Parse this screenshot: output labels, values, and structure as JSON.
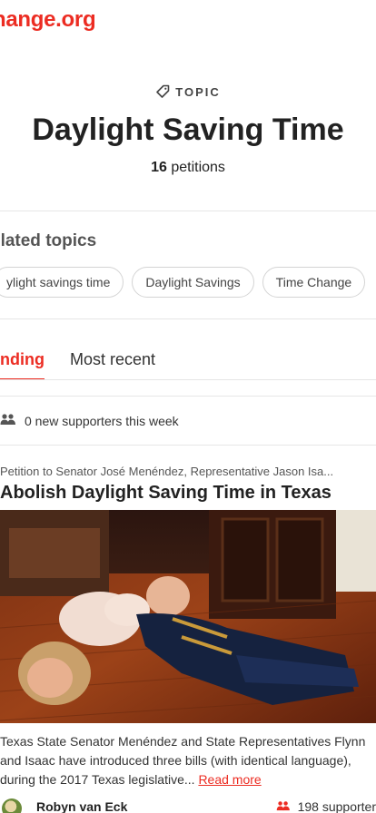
{
  "header": {
    "logo_text": "hange.org"
  },
  "topic": {
    "label": "TOPIC",
    "title": "Daylight Saving Time",
    "petition_count": "16",
    "petitions_word": "petitions"
  },
  "related": {
    "heading": "elated topics",
    "chips": [
      "ylight savings time",
      "Daylight Savings",
      "Time Change"
    ]
  },
  "tabs": {
    "trending": "ending",
    "recent": "Most recent"
  },
  "supporters_week": "0 new supporters this week",
  "petition": {
    "to_line": "Petition to Senator José Menéndez, Representative Jason Isa...",
    "title": "Abolish Daylight Saving Time in Texas",
    "description": "Texas State Senator Menéndez and State Representatives Flynn and Isaac have introduced three bills (with identical language), during the 2017 Texas legislative...",
    "read_more": "Read more",
    "author": "Robyn van Eck",
    "supporters": "198 supporter"
  },
  "colors": {
    "brand": "#ec2c22",
    "text": "#222222"
  },
  "icons": {
    "topic": "tag-icon",
    "supporters": "people-icon"
  }
}
